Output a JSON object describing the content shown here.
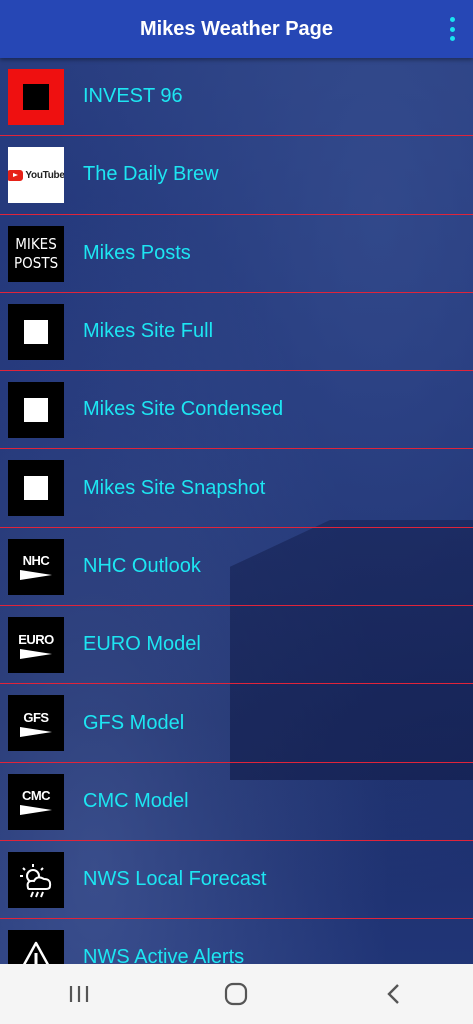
{
  "header": {
    "title": "Mikes Weather Page",
    "menu_icon": "more-vert-icon"
  },
  "colors": {
    "header_bg": "#2647b5",
    "accent": "#1de6f2",
    "divider": "#e0243a"
  },
  "items": [
    {
      "label": "INVEST 96",
      "icon": "invest-icon"
    },
    {
      "label": "The Daily Brew",
      "icon": "youtube-icon",
      "logo_text": "YouTube"
    },
    {
      "label": "Mikes Posts",
      "icon": "mikes-posts-icon",
      "logo_text": "MIKES POSTS"
    },
    {
      "label": "Mikes Site Full",
      "icon": "square-icon"
    },
    {
      "label": "Mikes Site Condensed",
      "icon": "square-icon"
    },
    {
      "label": "Mikes Site Snapshot",
      "icon": "square-icon"
    },
    {
      "label": "NHC Outlook",
      "icon": "nhc-logo-icon",
      "logo_text": "NHC"
    },
    {
      "label": "EURO Model",
      "icon": "euro-logo-icon",
      "logo_text": "EURO"
    },
    {
      "label": "GFS Model",
      "icon": "gfs-logo-icon",
      "logo_text": "GFS"
    },
    {
      "label": "CMC Model",
      "icon": "cmc-logo-icon",
      "logo_text": "CMC"
    },
    {
      "label": "NWS Local Forecast",
      "icon": "weather-cloud-icon"
    },
    {
      "label": "NWS Active Alerts",
      "icon": "warning-icon"
    }
  ],
  "navbar": [
    "recent-apps-icon",
    "home-icon",
    "back-icon"
  ]
}
